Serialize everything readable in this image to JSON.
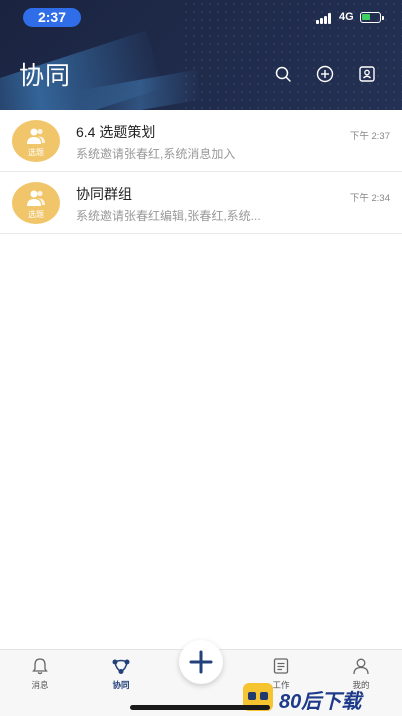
{
  "status_bar": {
    "time": "2:37",
    "network": "4G"
  },
  "header": {
    "title": "协同"
  },
  "conversations": [
    {
      "avatar_tag": "选题",
      "title": "6.4 选题策划",
      "preview": "系统邀请张春红,系统消息加入",
      "time": "下午 2:37"
    },
    {
      "avatar_tag": "选题",
      "title": "协同群组",
      "preview": "系统邀请张春红编辑,张春红,系统...",
      "time": "下午 2:34"
    }
  ],
  "tabbar": {
    "tabs": [
      {
        "label": "消息",
        "icon": "bell-icon"
      },
      {
        "label": "协同",
        "icon": "collaborate-icon"
      },
      {
        "label": "工作",
        "icon": "document-icon"
      },
      {
        "label": "我的",
        "icon": "user-icon"
      }
    ],
    "active": "协同"
  },
  "watermark": {
    "text": "80后下载"
  },
  "colors": {
    "header_bg": "#1f2a4a",
    "accent": "#22407a",
    "avatar": "#f1c66a",
    "time_pill": "#2f6ee8"
  }
}
